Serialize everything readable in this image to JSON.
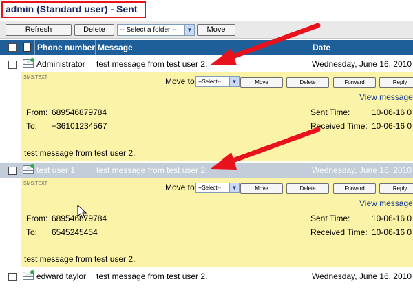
{
  "page_title": "admin (Standard user) - Sent",
  "toolbar": {
    "refresh_label": "Refresh",
    "delete_label": "Delete",
    "folder_select_value": "-- Select a folder --",
    "move_label": "Move"
  },
  "table": {
    "col_phone": "Phone number",
    "col_message": "Message",
    "col_date": "Date"
  },
  "rows": [
    {
      "phone": "Administrator",
      "message": "test message from test user 2.",
      "date": "Wednesday, June 16, 2010"
    },
    {
      "phone": "test user 1",
      "message": "test message from test user 2.",
      "date": "Wednesday, June 16, 2010"
    },
    {
      "phone": "edward taylor",
      "message": "test message from test user 2.",
      "date": "Wednesday, June 16, 2010"
    }
  ],
  "details": [
    {
      "type": "SMS:TEXT",
      "move_to": "Move to:",
      "select_value": "--Select--",
      "move": "Move",
      "delete": "Delete",
      "forward": "Forward",
      "reply": "Reply",
      "view_message": "View message",
      "from_label": "From:",
      "from_value": "689546879784",
      "to_label": "To:",
      "to_value": "+36101234567",
      "sent_label": "Sent Time:",
      "sent_value": "10-06-16 0",
      "received_label": "Received Time:",
      "received_value": "10-06-16 0",
      "body": "test message from test user 2."
    },
    {
      "type": "SMS:TEXT",
      "move_to": "Move to:",
      "select_value": "--Select--",
      "move": "Move",
      "delete": "Delete",
      "forward": "Forward",
      "reply": "Reply",
      "view_message": "View message",
      "from_label": "From:",
      "from_value": "689546879784",
      "to_label": "To:",
      "to_value": "6545245454",
      "sent_label": "Sent Time:",
      "sent_value": "10-06-16 0",
      "received_label": "Received Time:",
      "received_value": "10-06-16 0",
      "body": "test message from test user 2."
    }
  ],
  "colors": {
    "header_bg": "#1e5f99",
    "detail_bg": "#fbf3a7",
    "selected_row_bg": "#c3cdd9",
    "annotation_red": "#e8121d"
  }
}
